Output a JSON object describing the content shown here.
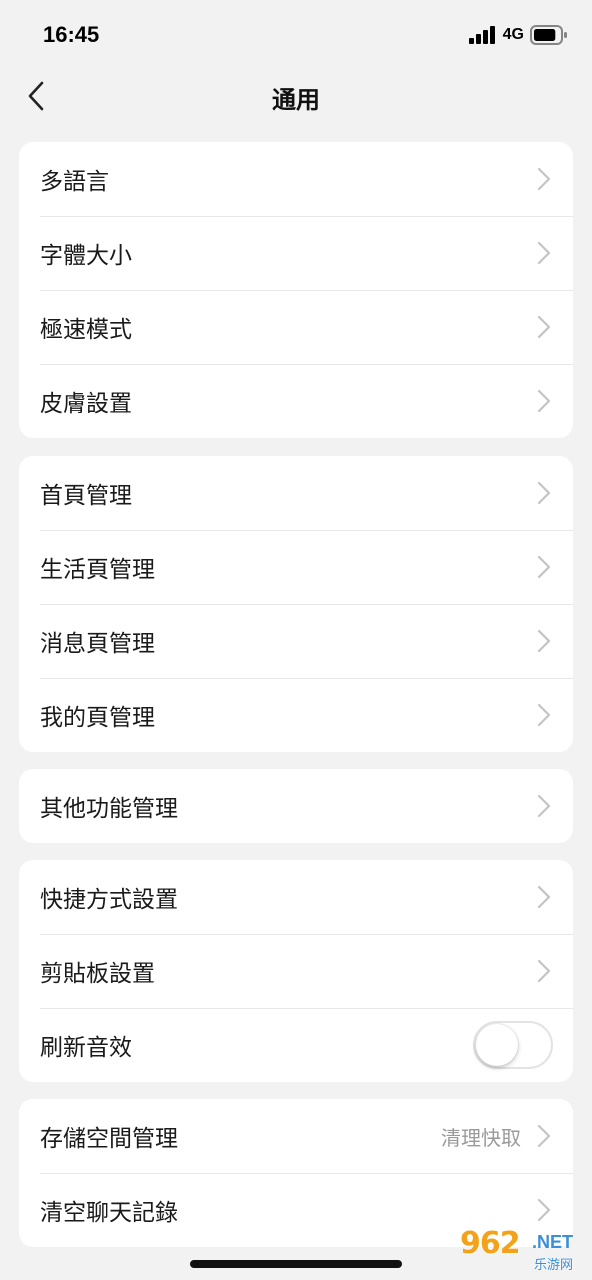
{
  "status_bar": {
    "time": "16:45",
    "network": "4G",
    "battery_level": 0.85
  },
  "nav": {
    "title": "通用",
    "back_icon": "chevron-left-icon"
  },
  "groups": [
    {
      "items": [
        {
          "label": "多語言",
          "type": "link"
        },
        {
          "label": "字體大小",
          "type": "link"
        },
        {
          "label": "極速模式",
          "type": "link"
        },
        {
          "label": "皮膚設置",
          "type": "link"
        }
      ]
    },
    {
      "items": [
        {
          "label": "首頁管理",
          "type": "link"
        },
        {
          "label": "生活頁管理",
          "type": "link"
        },
        {
          "label": "消息頁管理",
          "type": "link"
        },
        {
          "label": "我的頁管理",
          "type": "link"
        }
      ]
    },
    {
      "items": [
        {
          "label": "其他功能管理",
          "type": "link"
        }
      ]
    },
    {
      "items": [
        {
          "label": "快捷方式設置",
          "type": "link"
        },
        {
          "label": "剪貼板設置",
          "type": "link"
        },
        {
          "label": "刷新音效",
          "type": "toggle",
          "on": false
        }
      ]
    },
    {
      "items": [
        {
          "label": "存儲空間管理",
          "type": "link",
          "value": "清理快取"
        },
        {
          "label": "清空聊天記錄",
          "type": "link"
        }
      ]
    }
  ],
  "watermark": {
    "number": "962",
    "suffix": ".NET",
    "site": "乐游网"
  },
  "colors": {
    "background": "#f2f2f2",
    "card": "#ffffff",
    "chevron": "#c4c4c4",
    "secondary_text": "#9a9a9a"
  }
}
